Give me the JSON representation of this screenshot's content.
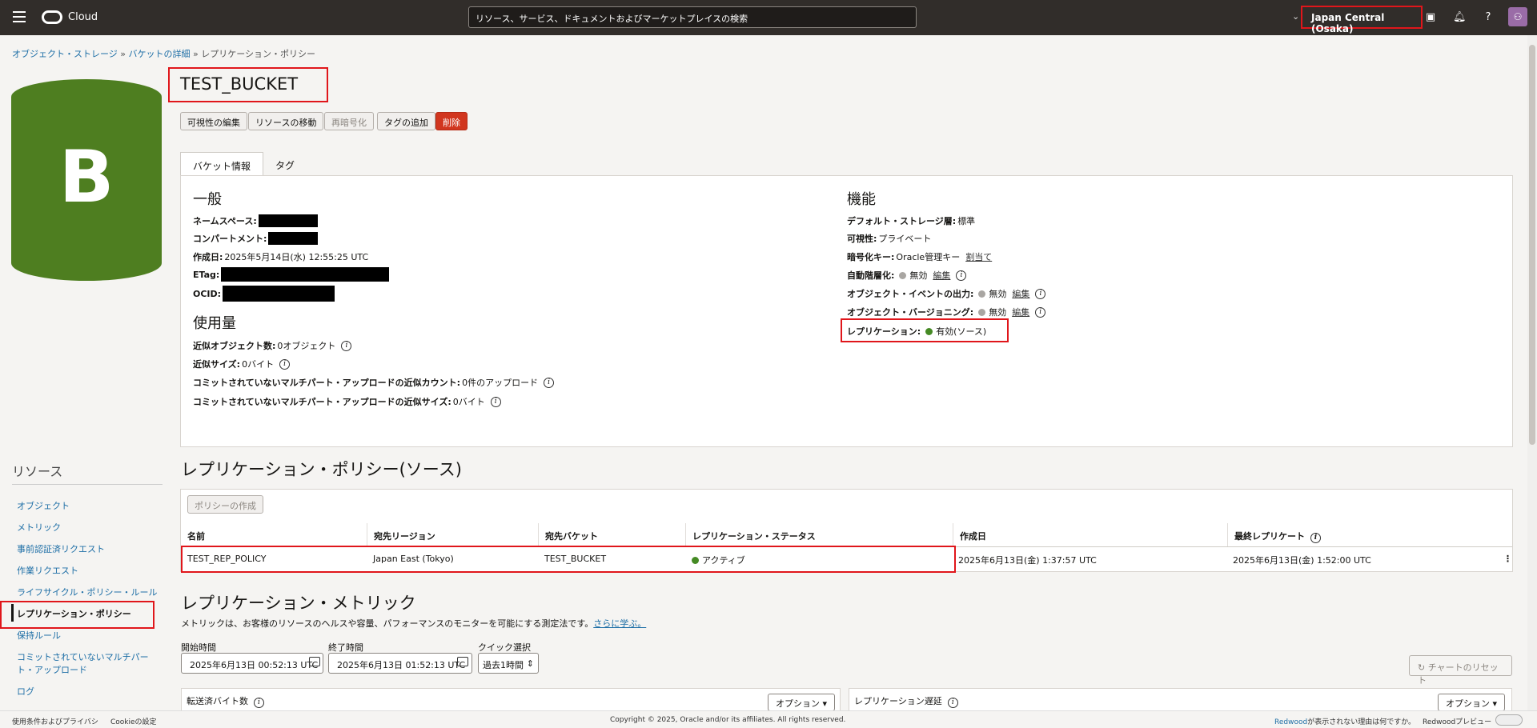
{
  "header": {
    "brand": "Cloud",
    "search_placeholder": "リソース、サービス、ドキュメントおよびマーケットプレイスの検索",
    "region": "Japan Central (Osaka)"
  },
  "breadcrumb": {
    "item1": "オブジェクト・ストレージ",
    "item2": "バケットの詳細",
    "current": "レプリケーション・ポリシー",
    "sep": "»"
  },
  "bucket": {
    "letter": "B",
    "name": "TEST_BUCKET",
    "icon_color": "#4e7e20"
  },
  "actions": {
    "edit_visibility": "可視性の編集",
    "move_resource": "リソースの移動",
    "reencrypt": "再暗号化",
    "add_tag": "タグの追加",
    "delete": "削除"
  },
  "tabs": {
    "bucket_info": "バケット情報",
    "tags": "タグ"
  },
  "general": {
    "title": "一般",
    "namespace_label": "ネームスペース:",
    "compartment_label": "コンパートメント:",
    "created_label": "作成日:",
    "created_value": "2025年5月14日(水) 12:55:25 UTC",
    "etag_label": "ETag:",
    "ocid_label": "OCID:"
  },
  "usage": {
    "title": "使用量",
    "objects_label": "近似オブジェクト数:",
    "objects_value": "0オブジェクト",
    "size_label": "近似サイズ:",
    "size_value": "0バイト",
    "multipart_count_label": "コミットされていないマルチパート・アップロードの近似カウント:",
    "multipart_count_value": "0件のアップロード",
    "multipart_size_label": "コミットされていないマルチパート・アップロードの近似サイズ:",
    "multipart_size_value": "0バイト"
  },
  "features": {
    "title": "機能",
    "storage_tier_label": "デフォルト・ストレージ層:",
    "storage_tier_value": "標準",
    "visibility_label": "可視性:",
    "visibility_value": "プライベート",
    "encryption_label": "暗号化キー:",
    "encryption_value": "Oracle管理キー",
    "encryption_link": "割当て",
    "auto_tiering_label": "自動階層化:",
    "auto_tiering_value": "無効",
    "events_label": "オブジェクト・イベントの出力:",
    "events_value": "無効",
    "versioning_label": "オブジェクト・バージョニング:",
    "versioning_value": "無効",
    "edit_link": "編集",
    "replication_label": "レプリケーション:",
    "replication_value": "有効(ソース)"
  },
  "sidebar": {
    "title": "リソース",
    "items": [
      "オブジェクト",
      "メトリック",
      "事前認証済リクエスト",
      "作業リクエスト",
      "ライフサイクル・ポリシー・ルール",
      "レプリケーション・ポリシー",
      "保持ルール",
      "コミットされていないマルチパー",
      "ト・アップロード",
      "ログ"
    ]
  },
  "policy_section": {
    "title": "レプリケーション・ポリシー(ソース)",
    "create_button": "ポリシーの作成",
    "columns": [
      "名前",
      "宛先リージョン",
      "宛先バケット",
      "レプリケーション・ステータス",
      "作成日",
      "最終レプリケート"
    ],
    "rows": [
      {
        "name": "TEST_REP_POLICY",
        "dest_region": "Japan East (Tokyo)",
        "dest_bucket": "TEST_BUCKET",
        "status": "アクティブ",
        "created": "2025年6月13日(金) 1:37:57 UTC",
        "last_replicated": "2025年6月13日(金) 1:52:00 UTC"
      }
    ]
  },
  "metrics": {
    "title": "レプリケーション・メトリック",
    "description": "メトリックは、お客様のリソースのヘルスや容量、パフォーマンスのモニターを可能にする測定法です。",
    "learn_more": "さらに学ぶ。",
    "start_label": "開始時間",
    "start_value": "2025年6月13日 00:52:13 UTC",
    "end_label": "終了時間",
    "end_value": "2025年6月13日 01:52:13 UTC",
    "quick_label": "クイック選択",
    "quick_value": "過去1時間",
    "reset_chart": "チャートのリセット",
    "chart1_title": "転送済バイト数",
    "chart2_title": "レプリケーション遅延",
    "options": "オプション"
  },
  "footer": {
    "terms": "使用条件およびプライバシ",
    "cookies": "Cookieの設定",
    "copyright": "Copyright © 2025, Oracle and/or its affiliates. All rights reserved.",
    "redwood": "Redwood",
    "redwood_text": "が表示されない理由は何ですか。",
    "preview": "Redwoodプレビュー"
  }
}
